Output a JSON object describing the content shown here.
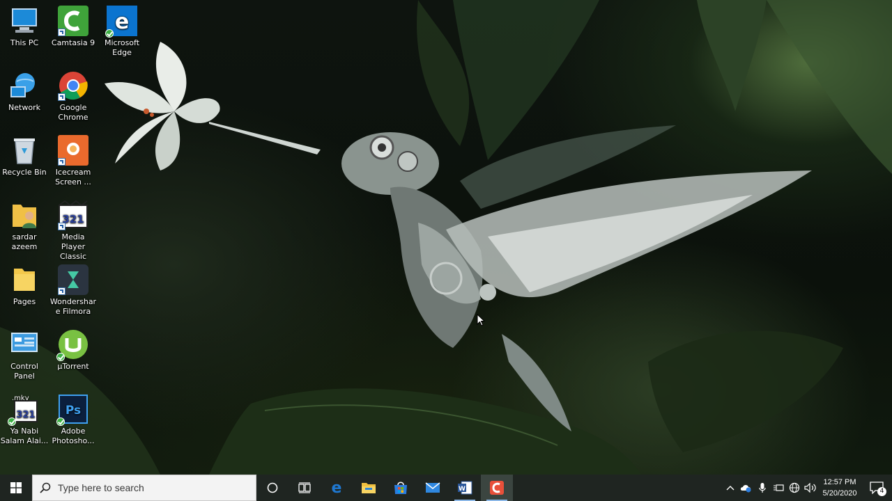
{
  "desktop": {
    "icons": [
      {
        "label": "This PC"
      },
      {
        "label": "Camtasia 9"
      },
      {
        "label": "Microsoft Edge"
      },
      {
        "label": "Network"
      },
      {
        "label": "Google Chrome"
      },
      {
        "label": "Recycle Bin"
      },
      {
        "label": "Icecream Screen ..."
      },
      {
        "label": "sardar azeem"
      },
      {
        "label": "Media Player Classic"
      },
      {
        "label": "Pages"
      },
      {
        "label": "Wondershare Filmora"
      },
      {
        "label": "Control Panel"
      },
      {
        "label": "µTorrent"
      },
      {
        "label": "Ya Nabi Salam Alai..."
      },
      {
        "label": "Adobe Photosho..."
      }
    ],
    "mkv_badge": ".mkv",
    "mpc_badge": "321",
    "ps_badge": "Ps"
  },
  "taskbar": {
    "search_placeholder": "Type here to search",
    "pinned": [
      "cortana-icon",
      "task-view-icon",
      "edge-icon",
      "file-explorer-icon",
      "store-icon",
      "mail-icon",
      "word-icon",
      "camtasia-icon"
    ],
    "clock_time": "12:57 PM",
    "clock_date": "5/20/2020",
    "notification_count": "4"
  },
  "colors": {
    "taskbar": "#1f2521",
    "accent_blue": "#1f78d1",
    "camtasia_active": "#e8503a"
  }
}
